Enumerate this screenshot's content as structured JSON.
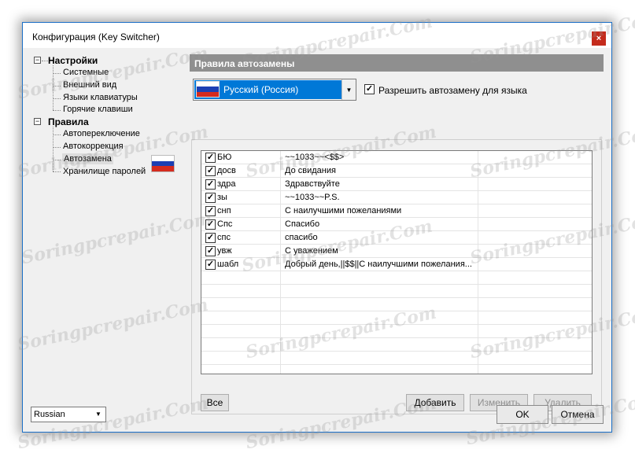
{
  "window": {
    "title": "Конфигурация (Key Switcher)",
    "close": "×"
  },
  "tree": {
    "settings_label": "Настройки",
    "settings_items": [
      "Системные",
      "Внешний вид",
      "Языки клавиатуры",
      "Горячие клавиши"
    ],
    "rules_label": "Правила",
    "rules_items": [
      "Автопереключение",
      "Автокоррекция",
      "Автозамена",
      "Хранилище паролей"
    ]
  },
  "panel": {
    "header": "Правила автозамены",
    "language_selected": "Русский (Россия)",
    "allow_label": "Разрешить автозамену для языка",
    "allow_checked": true
  },
  "list": {
    "rows": [
      {
        "abbr": "БЮ",
        "text": "~~1033~~<$$>",
        "checked": true
      },
      {
        "abbr": "досв",
        "text": "До свидания",
        "checked": true
      },
      {
        "abbr": "здра",
        "text": "Здравствуйте",
        "checked": true
      },
      {
        "abbr": "зы",
        "text": "~~1033~~P.S.",
        "checked": true
      },
      {
        "abbr": "снп",
        "text": "С наилучшими пожеланиями",
        "checked": true
      },
      {
        "abbr": "Спс",
        "text": "Спасибо",
        "checked": true
      },
      {
        "abbr": "спс",
        "text": "спасибо",
        "checked": true
      },
      {
        "abbr": "увж",
        "text": "С уважением",
        "checked": true
      },
      {
        "abbr": "шабл",
        "text": "Добрый день,||$$||С наилучшими пожелания...",
        "checked": true
      }
    ]
  },
  "buttons": {
    "all": "Все",
    "add": "Добавить",
    "edit": "Изменить",
    "delete": "Удалить",
    "ok": "OK",
    "cancel": "Отмена"
  },
  "ui_language": "Russian",
  "watermark": "Soringpcrepair.Com",
  "colors": {
    "accent": "#0078d7",
    "close": "#c42b1c",
    "header": "#8f8f8f"
  }
}
